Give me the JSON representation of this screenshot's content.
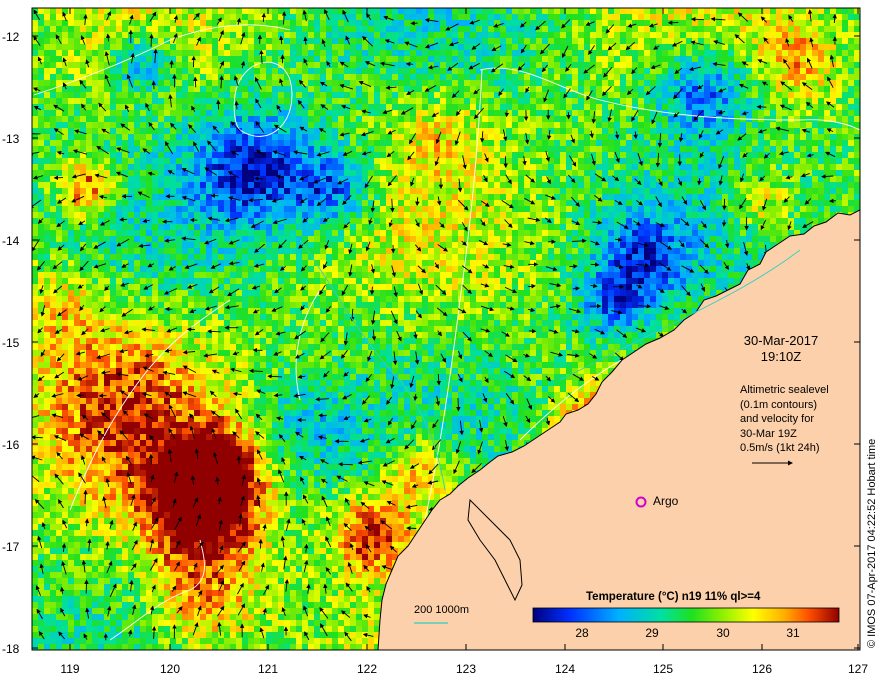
{
  "map": {
    "date": "30-Mar-2017",
    "time": "19:10Z",
    "lat_labels": [
      "-12",
      "-13",
      "-14",
      "-15",
      "-16",
      "-17",
      "-18"
    ],
    "lon_labels": [
      "119",
      "120",
      "121",
      "122",
      "123",
      "124",
      "125",
      "126",
      "127"
    ],
    "altimetry_lines": [
      "Altimetric sealevel",
      "(0.1m contours)",
      "and velocity for",
      "30-Mar 19Z",
      "0.5m/s (1kt 24h)"
    ],
    "argo_label": "Argo",
    "depth_legend": "200  1000m",
    "colorbar": {
      "title": "Temperature (°C) n19 11% ql>=4",
      "ticks": [
        "28",
        "29",
        "30",
        "31"
      ],
      "tick_values": [
        28,
        29,
        30,
        31
      ],
      "range": [
        27.4,
        31.7
      ]
    },
    "credit": "© IMOS 07-Apr-2017 04:22:52 Hobart time",
    "colors": {
      "land": "#fcd0aa",
      "argo_marker": "#d000d0",
      "contour": "#ffffff",
      "isobath": "#30d0c0",
      "coast": "#000000"
    }
  }
}
